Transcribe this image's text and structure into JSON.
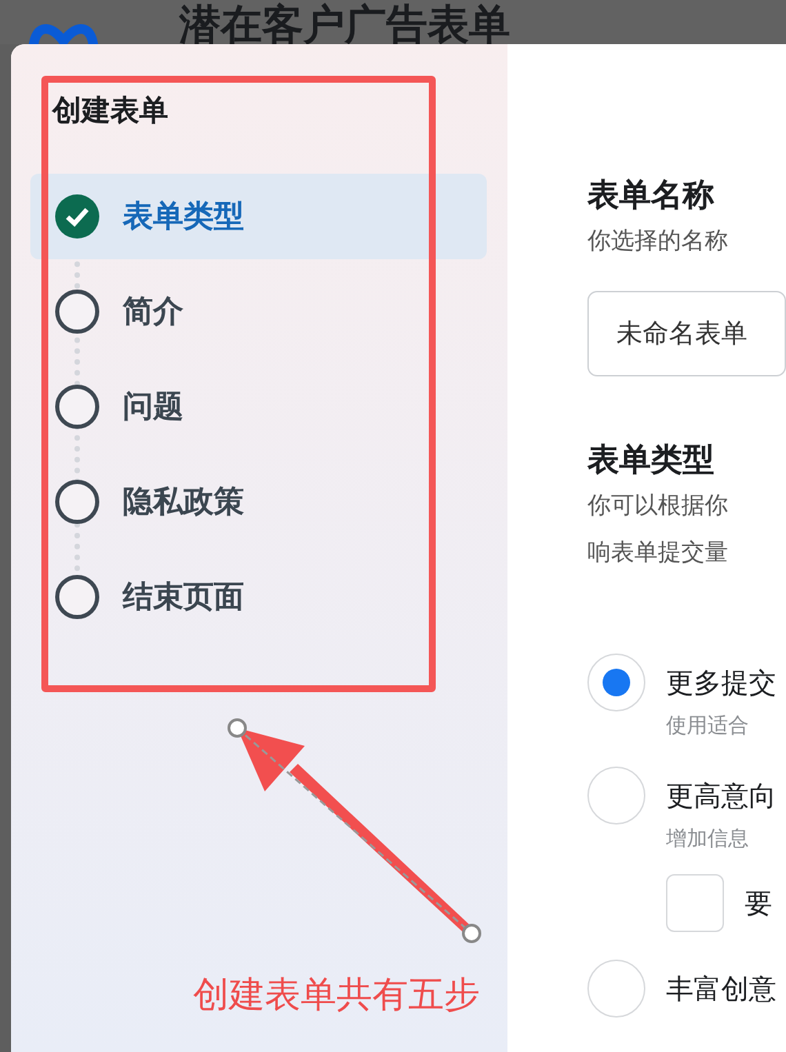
{
  "background": {
    "title": "潜在客户广告表单"
  },
  "sidebar": {
    "title": "创建表单",
    "steps": [
      {
        "label": "表单类型",
        "completed": true,
        "selected": true
      },
      {
        "label": "简介",
        "completed": false,
        "selected": false
      },
      {
        "label": "问题",
        "completed": false,
        "selected": false
      },
      {
        "label": "隐私政策",
        "completed": false,
        "selected": false
      },
      {
        "label": "结束页面",
        "completed": false,
        "selected": false
      }
    ]
  },
  "form": {
    "name_section": {
      "heading": "表单名称",
      "description": "你选择的名称",
      "value": "未命名表单"
    },
    "type_section": {
      "heading": "表单类型",
      "description_lines": [
        "你可以根据你",
        "响表单提交量"
      ],
      "options": [
        {
          "label": "更多提交",
          "hint": "使用适合",
          "selected": true
        },
        {
          "label": "更高意向",
          "hint": "增加信息",
          "selected": false,
          "checkbox": {
            "label": "要",
            "checked": false
          }
        },
        {
          "label": "丰富创意",
          "selected": false
        }
      ]
    }
  },
  "annotation": {
    "caption": "创建表单共有五步"
  }
}
